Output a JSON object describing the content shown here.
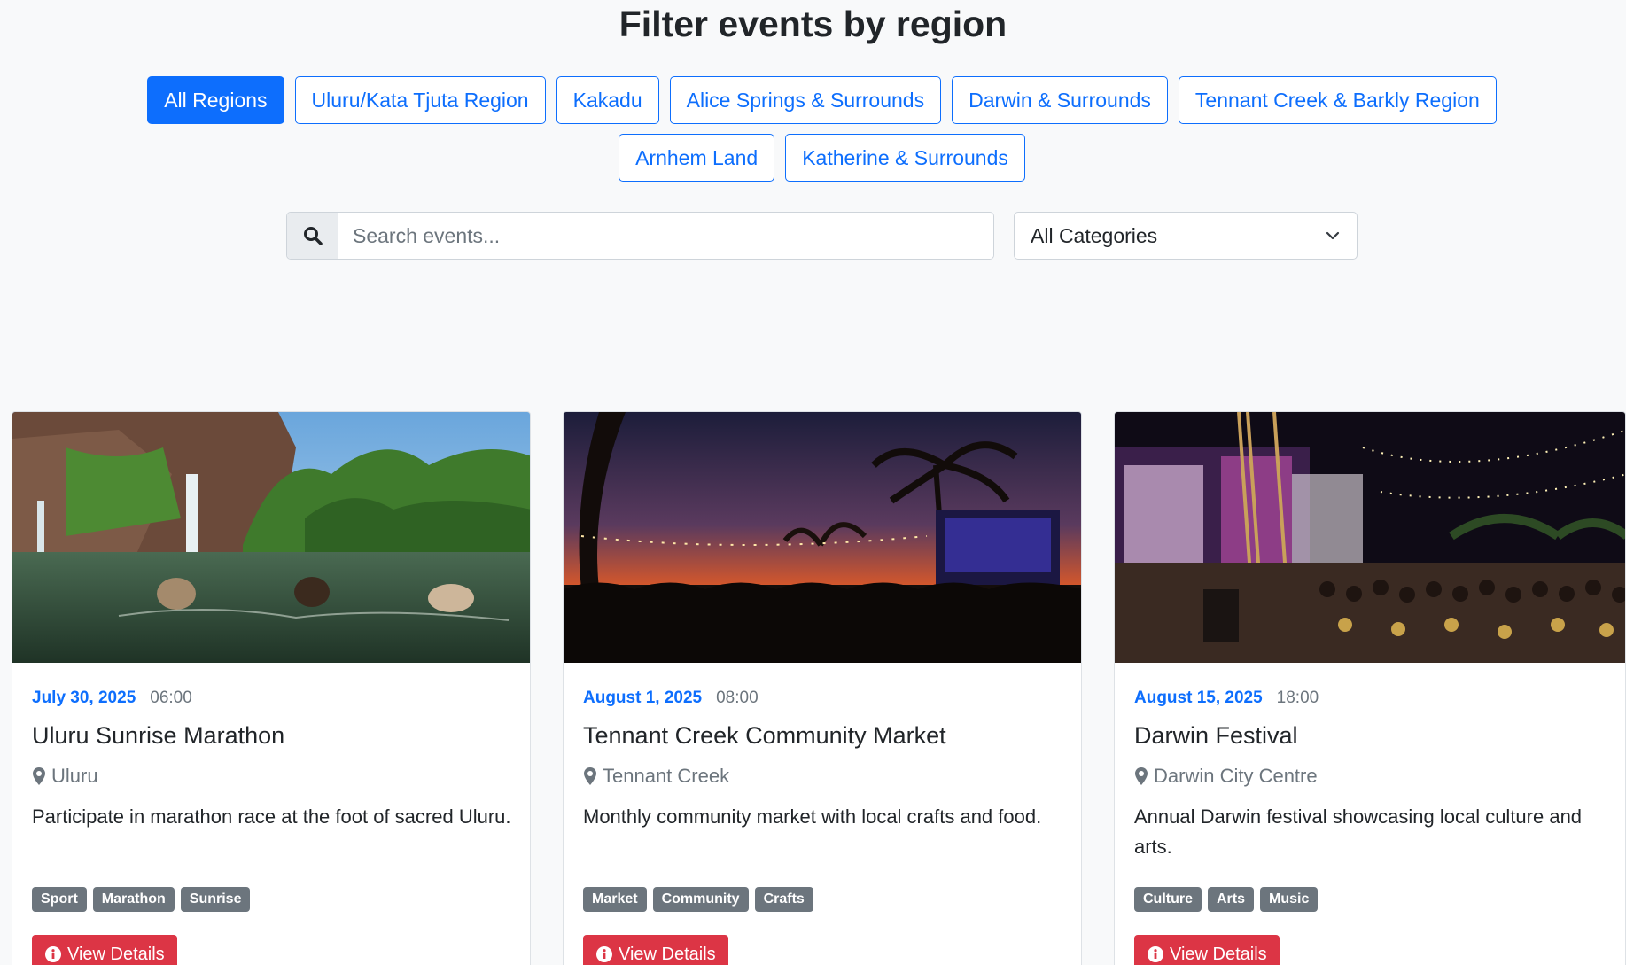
{
  "header": {
    "title": "Filter events by region"
  },
  "regions": [
    {
      "label": "All Regions",
      "active": true
    },
    {
      "label": "Uluru/Kata Tjuta Region",
      "active": false
    },
    {
      "label": "Kakadu",
      "active": false
    },
    {
      "label": "Alice Springs & Surrounds",
      "active": false
    },
    {
      "label": "Darwin & Surrounds",
      "active": false
    },
    {
      "label": "Tennant Creek & Barkly Region",
      "active": false
    },
    {
      "label": "Arnhem Land",
      "active": false
    },
    {
      "label": "Katherine & Surrounds",
      "active": false
    }
  ],
  "search": {
    "placeholder": "Search events...",
    "value": ""
  },
  "category": {
    "selected": "All Categories"
  },
  "events": [
    {
      "date": "July 30, 2025",
      "time": "06:00",
      "title": "Uluru Sunrise Marathon",
      "location": "Uluru",
      "description": "Participate in marathon race at the foot of sacred Uluru.",
      "tags": [
        "Sport",
        "Marathon",
        "Sunrise"
      ],
      "button": "View Details"
    },
    {
      "date": "August 1, 2025",
      "time": "08:00",
      "title": "Tennant Creek Community Market",
      "location": "Tennant Creek",
      "description": "Monthly community market with local crafts and food.",
      "tags": [
        "Market",
        "Community",
        "Crafts"
      ],
      "button": "View Details"
    },
    {
      "date": "August 15, 2025",
      "time": "18:00",
      "title": "Darwin Festival",
      "location": "Darwin City Centre",
      "description": "Annual Darwin festival showcasing local culture and arts.",
      "tags": [
        "Culture",
        "Arts",
        "Music"
      ],
      "button": "View Details"
    }
  ],
  "colors": {
    "primary": "#0d6efd",
    "danger": "#dc3545",
    "secondary": "#6c757d"
  }
}
